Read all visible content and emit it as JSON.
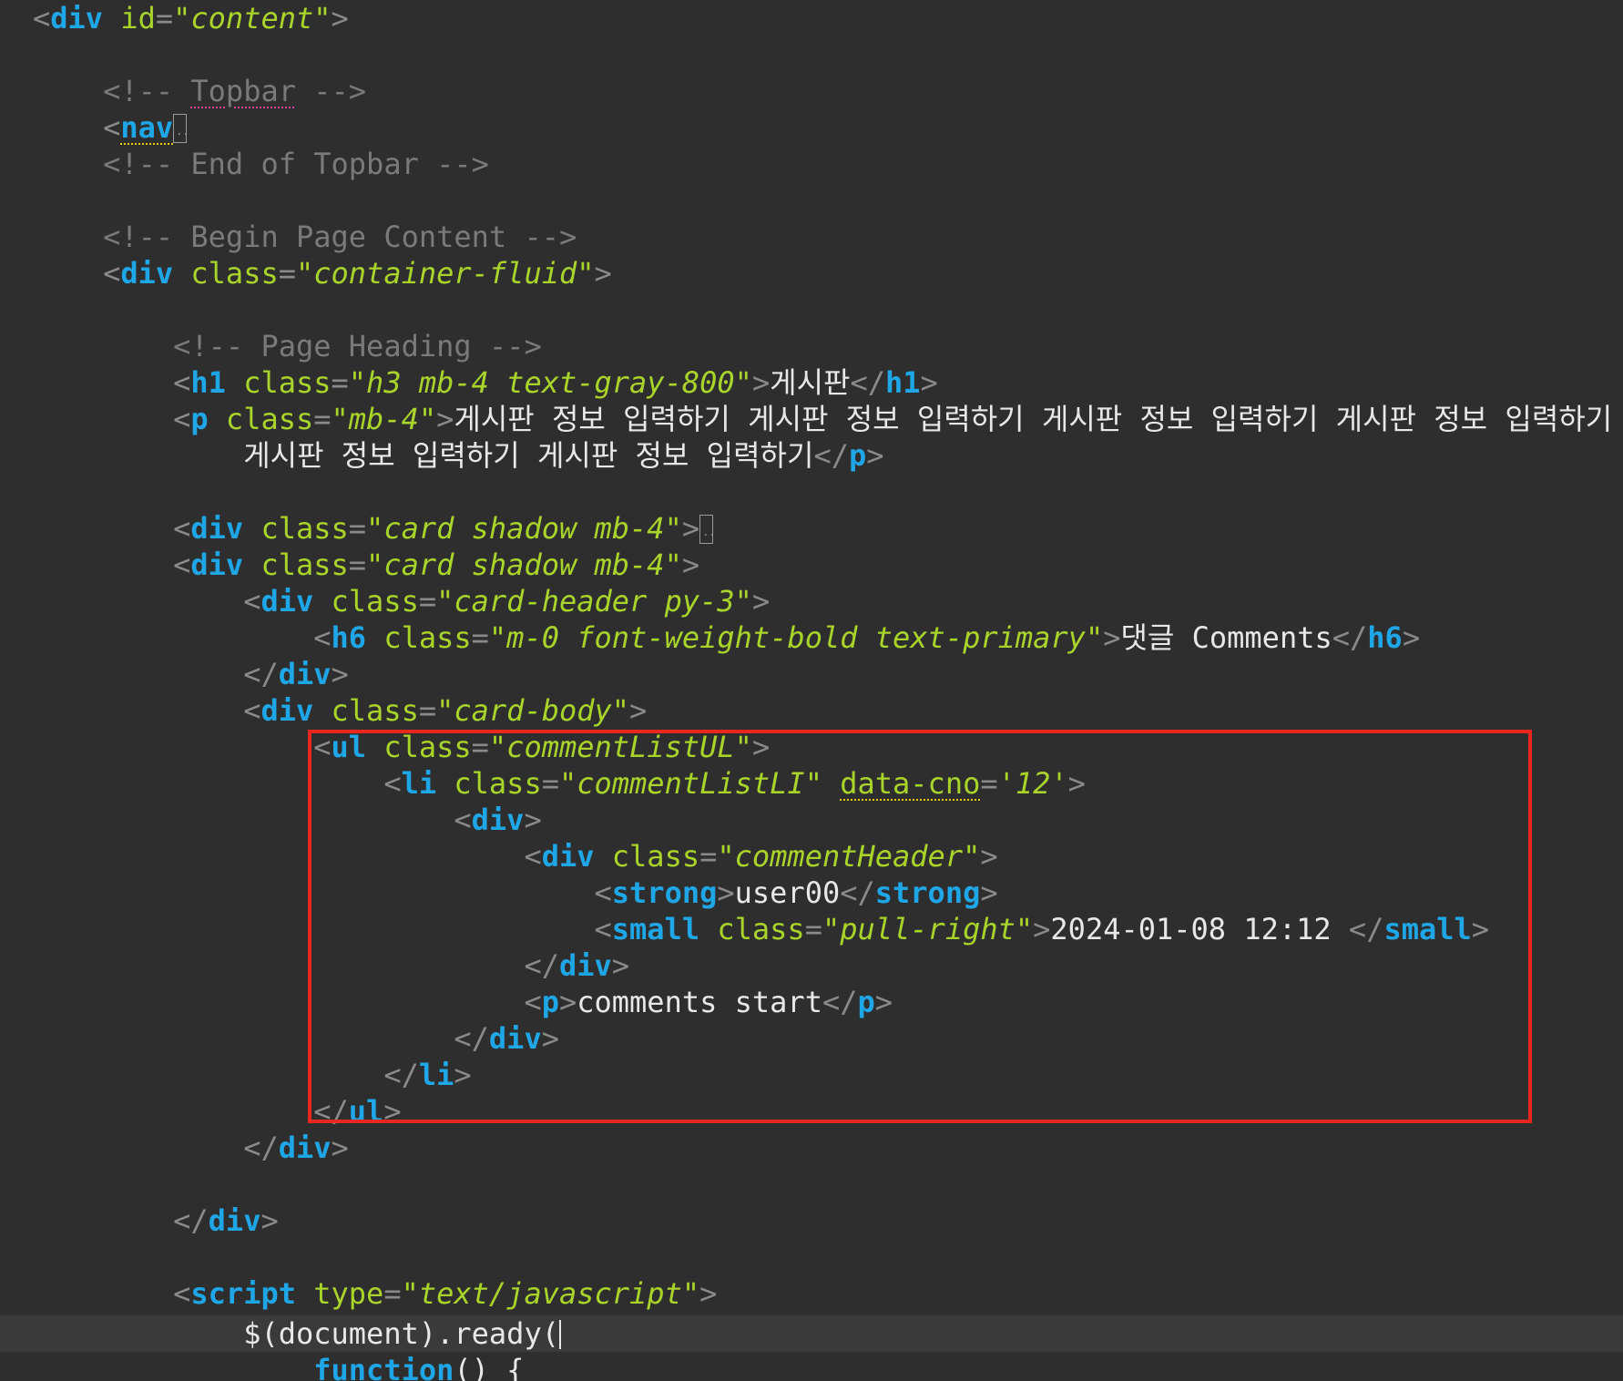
{
  "code": {
    "content_id": "content",
    "topbar_comment": "Topbar",
    "nav_tag": "nav",
    "end_topbar_comment": "End of Topbar",
    "begin_page_comment": "Begin Page Content",
    "container_class": "container-fluid",
    "page_heading_comment": "Page Heading",
    "h1_class": "h3 mb-4 text-gray-800",
    "h1_text": "게시판",
    "p_class": "mb-4",
    "p_text_line1": "게시판 정보 입력하기 게시판 정보 입력하기 게시판 정보 입력하기 게시판 정보 입력하기",
    "p_text_line2": "게시판 정보 입력하기 게시판 정보 입력하기",
    "card_class": "card shadow mb-4",
    "card_header_class": "card-header py-3",
    "h6_class": "m-0 font-weight-bold text-primary",
    "h6_text": "댓글 Comments",
    "card_body_class": "card-body",
    "ul_class": "commentListUL",
    "li_class": "commentListLI",
    "data_cno_attr": "data-cno",
    "data_cno_value": "12",
    "comment_header_class": "commentHeader",
    "comment_user": "user00",
    "small_class": "pull-right",
    "comment_date": "2024-01-08 12:12 ",
    "comment_text": "comments start",
    "script_type": "text/javascript",
    "ready_call": "$(document).ready(",
    "function_kw": "function",
    "function_tail": "() {"
  },
  "colors": {
    "background": "#2e2e2e",
    "tag": "#1ea6e6",
    "attribute": "#a9d42a",
    "comment": "#7a7a7a",
    "text": "#e8e8e8",
    "highlight_box": "#e8281e"
  }
}
